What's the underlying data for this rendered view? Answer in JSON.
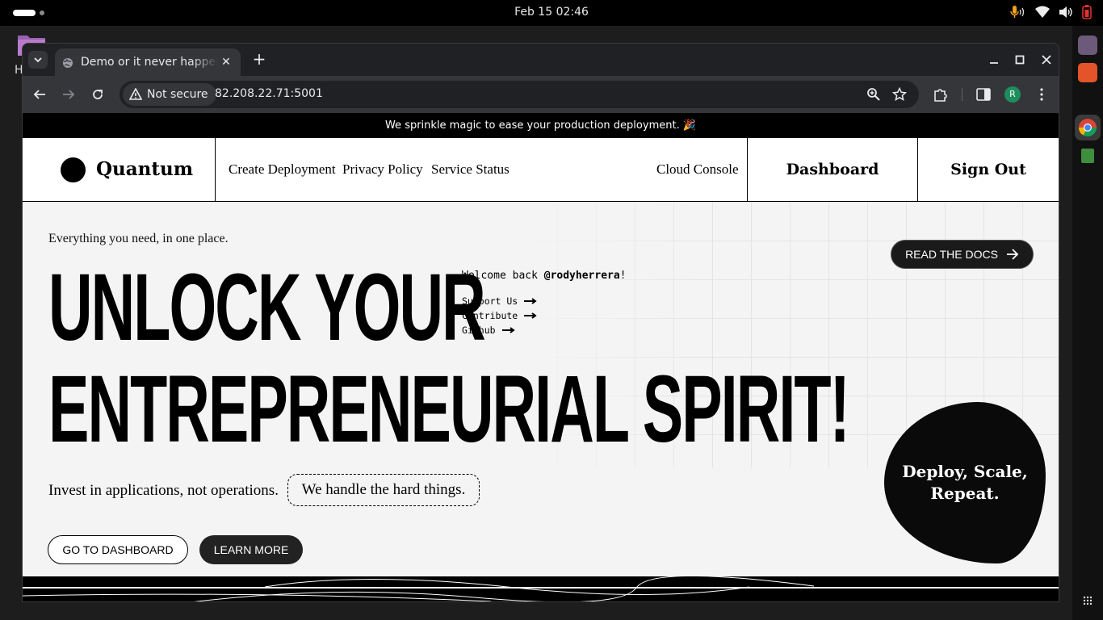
{
  "system": {
    "clock": "Feb 15  02:46",
    "desktop_letter": "H"
  },
  "browser": {
    "tab_title": "Demo or it never happened",
    "security_label": "Not secure",
    "url": "82.208.22.71:5001",
    "profile_initial": "R"
  },
  "page": {
    "announcement": "We sprinkle magic to ease your production deployment. 🎉",
    "brand": "Quantum",
    "nav_links": [
      "Create Deployment",
      "Privacy Policy",
      "Service Status"
    ],
    "cloud_console": "Cloud Console",
    "dashboard": "Dashboard",
    "sign_out": "Sign Out",
    "tagline": "Everything you need, in one place.",
    "headline_line1": "UNLOCK YOUR",
    "headline_line2": "ENTREPRENEURIAL SPIRIT!",
    "welcome_prefix": "Welcome back ",
    "username": "@rodyherrera",
    "welcome_suffix": "!",
    "mono_links": [
      "Support Us",
      "Contribute",
      "Github"
    ],
    "read_docs": "READ THE DOCS",
    "invest": "Invest in applications, not operations.",
    "hard_things": "We handle the hard things.",
    "go_dashboard": "GO TO DASHBOARD",
    "learn_more": "LEARN MORE",
    "blob_text": "Deploy, Scale, Repeat."
  },
  "colors": {
    "page_bg": "#f4f4f4",
    "accent": "#000000",
    "chrome_dark": "#202124",
    "chrome_toolbar": "#35363a"
  }
}
